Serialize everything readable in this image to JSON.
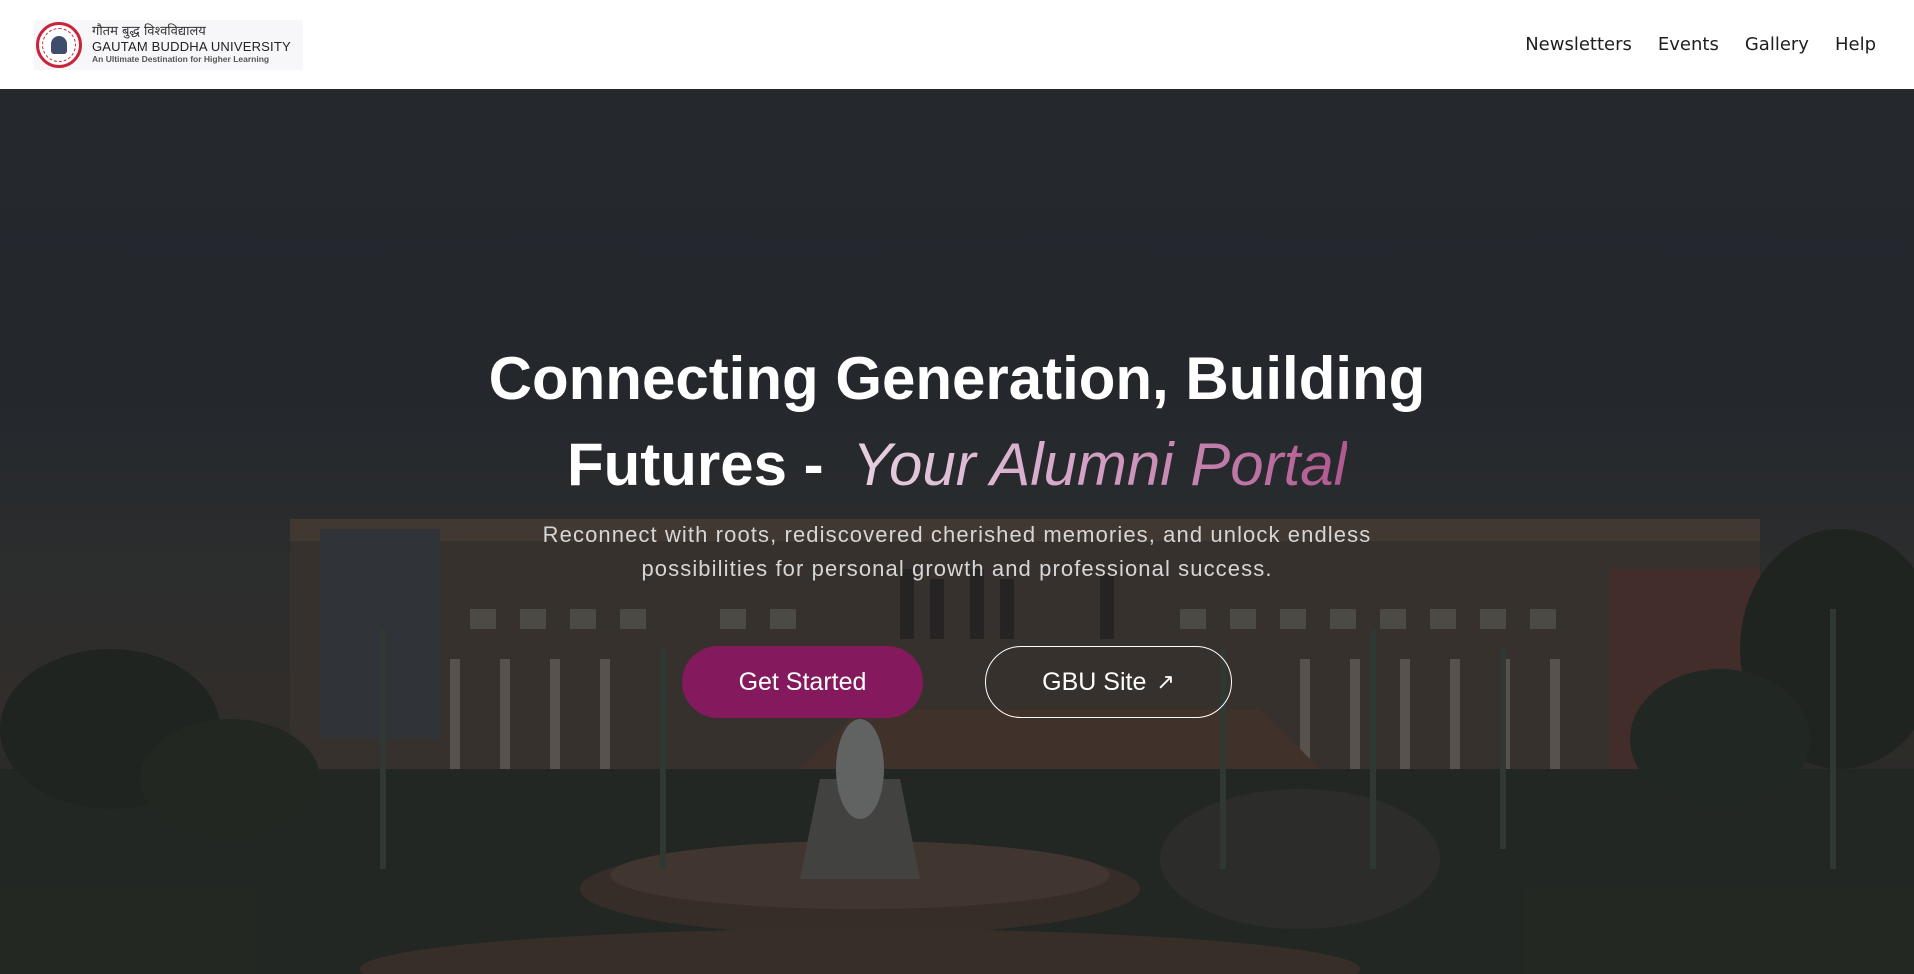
{
  "brand": {
    "hindi_name": "गौतम बुद्ध विश्वविद्यालय",
    "name": "GAUTAM BUDDHA UNIVERSITY",
    "tagline": "An Ultimate Destination for Higher Learning",
    "seal_icon": "university-seal-icon"
  },
  "nav": {
    "items": [
      {
        "label": "Newsletters"
      },
      {
        "label": "Events"
      },
      {
        "label": "Gallery"
      },
      {
        "label": "Help"
      }
    ]
  },
  "hero": {
    "headline_main": "Connecting Generation, Building Futures -",
    "headline_accent": "Your Alumni Portal",
    "subtitle": "Reconnect with roots, rediscovered cherished memories, and unlock endless possibilities for personal growth and professional success.",
    "primary_button": "Get Started",
    "secondary_button": "GBU Site",
    "secondary_icon": "↗",
    "background_image": "campus-building-fountain"
  },
  "colors": {
    "accent": "#85195d",
    "accent_gradient_start": "#e7d4e2",
    "accent_gradient_end": "#b0588f",
    "nav_bg": "#ffffff"
  }
}
